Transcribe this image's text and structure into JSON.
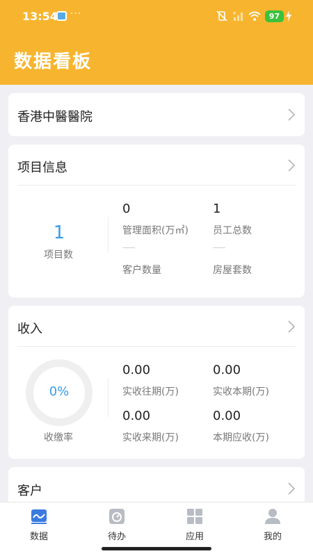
{
  "status_bar": {
    "time": "13:54",
    "battery": "97"
  },
  "header": {
    "title": "数据看板"
  },
  "project_card": {
    "name": "香港中醫醫院"
  },
  "info_card": {
    "title": "项目信息",
    "project_count": "1",
    "project_count_label": "项目数",
    "mgmt_area_value": "0",
    "mgmt_area_label": "管理面积(万㎡)",
    "staff_value": "1",
    "staff_label": "员工总数",
    "customer_label": "客户数量",
    "house_label": "房屋套数"
  },
  "income_card": {
    "title": "收入",
    "rate_value": "0%",
    "rate_label": "收缴率",
    "past_value": "0.00",
    "past_label": "实收往期(万)",
    "current_value": "0.00",
    "current_label": "实收本期(万)",
    "future_value": "0.00",
    "future_label": "实收来期(万)",
    "receivable_value": "0.00",
    "receivable_label": "本期应收(万)"
  },
  "customer_card": {
    "title": "客户"
  },
  "tabbar": {
    "tabs": [
      {
        "label": "数据",
        "icon": "chart-icon",
        "active": true
      },
      {
        "label": "待办",
        "icon": "timer-icon",
        "active": false
      },
      {
        "label": "应用",
        "icon": "grid-icon",
        "active": false
      },
      {
        "label": "我的",
        "icon": "user-icon",
        "active": false
      }
    ]
  },
  "colors": {
    "header": "#f7b52f",
    "accent": "#3a9be8",
    "background": "#f0f0f4"
  }
}
